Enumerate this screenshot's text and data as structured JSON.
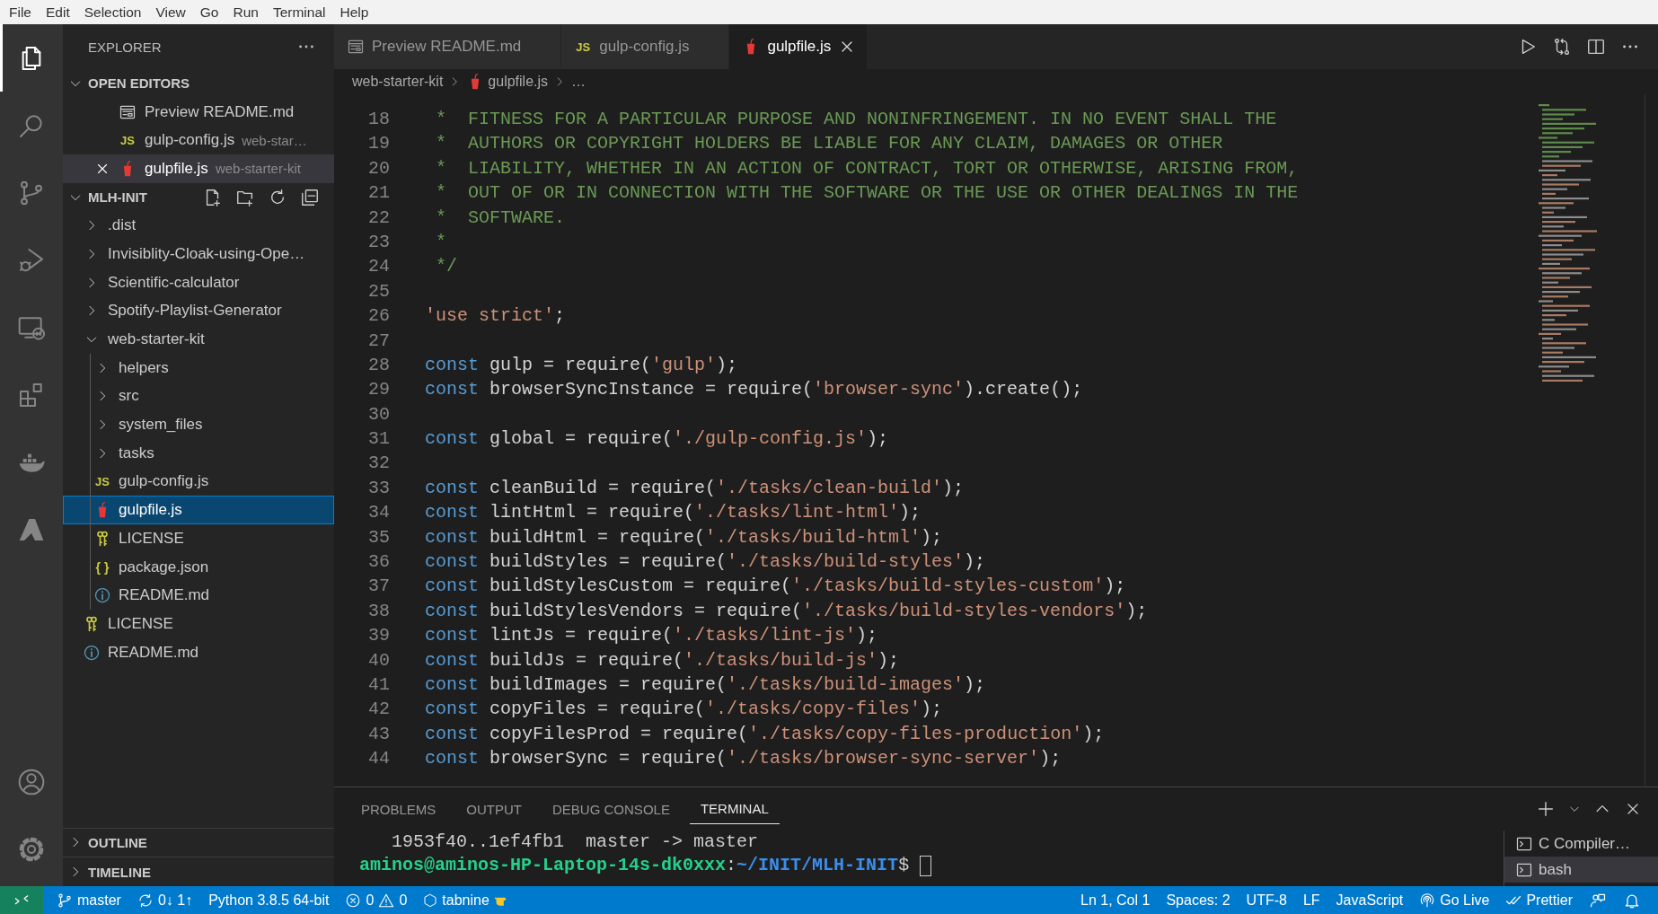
{
  "menu": [
    "File",
    "Edit",
    "Selection",
    "View",
    "Go",
    "Run",
    "Terminal",
    "Help"
  ],
  "activity_bar": {
    "top": [
      {
        "kind": "explorer",
        "selected": true
      },
      {
        "kind": "search",
        "selected": false
      },
      {
        "kind": "source-control",
        "selected": false
      },
      {
        "kind": "run-debug",
        "selected": false
      },
      {
        "kind": "remote",
        "selected": false
      },
      {
        "kind": "extensions",
        "selected": false
      },
      {
        "kind": "docker",
        "selected": false
      },
      {
        "kind": "azure",
        "selected": false
      }
    ],
    "bottom": [
      {
        "kind": "account",
        "selected": false
      },
      {
        "kind": "settings",
        "selected": false
      }
    ]
  },
  "sidebar": {
    "title": "EXPLORER",
    "open_editors": {
      "title": "OPEN EDITORS",
      "expanded": true,
      "items": [
        {
          "kind": "preview",
          "name": "Preview README.md",
          "selected": false
        },
        {
          "kind": "js",
          "icon_label": "JS",
          "name": "gulp-config.js",
          "description": "web-star…",
          "selected": false
        },
        {
          "kind": "gulp",
          "name": "gulpfile.js",
          "description": "web-starter-kit",
          "selected": true
        }
      ]
    },
    "folder": {
      "title": "MLH-INIT",
      "expanded": true,
      "children": [
        {
          "kind": "folder",
          "name": ".dist",
          "expanded": false,
          "selected": false
        },
        {
          "kind": "folder",
          "name": "Invisiblity-Cloak-using-Ope…",
          "expanded": false,
          "selected": false
        },
        {
          "kind": "folder",
          "name": "Scientific-calculator",
          "expanded": false,
          "selected": false
        },
        {
          "kind": "folder",
          "name": "Spotify-Playlist-Generator",
          "expanded": false,
          "selected": false
        },
        {
          "kind": "folder",
          "name": "web-starter-kit",
          "expanded": true,
          "selected": false,
          "children": [
            {
              "kind": "folder",
              "name": "helpers",
              "expanded": false,
              "selected": false
            },
            {
              "kind": "folder",
              "name": "src",
              "expanded": false,
              "selected": false
            },
            {
              "kind": "folder",
              "name": "system_files",
              "expanded": false,
              "selected": false
            },
            {
              "kind": "folder",
              "name": "tasks",
              "expanded": false,
              "selected": false
            },
            {
              "kind": "js",
              "icon_label": "JS",
              "name": "gulp-config.js",
              "selected": false
            },
            {
              "kind": "gulp",
              "name": "gulpfile.js",
              "selected": true
            },
            {
              "kind": "license",
              "name": "LICENSE",
              "selected": false
            },
            {
              "kind": "json",
              "icon_label": "{ }",
              "name": "package.json",
              "selected": false
            },
            {
              "kind": "info",
              "name": "README.md",
              "selected": false
            }
          ]
        },
        {
          "kind": "license",
          "name": "LICENSE",
          "selected": false
        },
        {
          "kind": "info",
          "name": "README.md",
          "selected": false
        }
      ]
    },
    "collapsed_sections": [
      {
        "title": "OUTLINE",
        "expanded": false
      },
      {
        "title": "TIMELINE",
        "expanded": false
      }
    ]
  },
  "tabs": [
    {
      "kind": "preview",
      "label": "Preview README.md",
      "selected": false
    },
    {
      "kind": "js",
      "icon_label": "JS",
      "label": "gulp-config.js",
      "selected": false
    },
    {
      "kind": "gulp",
      "label": "gulpfile.js",
      "selected": true
    }
  ],
  "breadcrumbs": [
    {
      "kind": "folder",
      "text": "web-starter-kit"
    },
    {
      "kind": "gulp",
      "text": "gulpfile.js"
    },
    {
      "kind": "more",
      "text": "…"
    }
  ],
  "code_lines": [
    {
      "number": "18",
      "tokens": [
        {
          "kind": "comment",
          "text": " *  FITNESS FOR A PARTICULAR PURPOSE AND NONINFRINGEMENT. IN NO EVENT SHALL THE"
        }
      ]
    },
    {
      "number": "19",
      "tokens": [
        {
          "kind": "comment",
          "text": " *  AUTHORS OR COPYRIGHT HOLDERS BE LIABLE FOR ANY CLAIM, DAMAGES OR OTHER"
        }
      ]
    },
    {
      "number": "20",
      "tokens": [
        {
          "kind": "comment",
          "text": " *  LIABILITY, WHETHER IN AN ACTION OF CONTRACT, TORT OR OTHERWISE, ARISING FROM,"
        }
      ]
    },
    {
      "number": "21",
      "tokens": [
        {
          "kind": "comment",
          "text": " *  OUT OF OR IN CONNECTION WITH THE SOFTWARE OR THE USE OR OTHER DEALINGS IN THE"
        }
      ]
    },
    {
      "number": "22",
      "tokens": [
        {
          "kind": "comment",
          "text": " *  SOFTWARE."
        }
      ]
    },
    {
      "number": "23",
      "tokens": [
        {
          "kind": "comment",
          "text": " *"
        }
      ]
    },
    {
      "number": "24",
      "tokens": [
        {
          "kind": "comment",
          "text": " */"
        }
      ]
    },
    {
      "number": "25"
    },
    {
      "number": "26",
      "tokens": [
        {
          "kind": "string",
          "text": "'use strict'"
        },
        {
          "kind": "plain",
          "text": ";"
        }
      ]
    },
    {
      "number": "27"
    },
    {
      "number": "28",
      "tokens": [
        {
          "kind": "keyword",
          "text": "const"
        },
        {
          "kind": "plain",
          "text": " gulp = require("
        },
        {
          "kind": "string",
          "text": "'gulp'"
        },
        {
          "kind": "plain",
          "text": ");"
        }
      ]
    },
    {
      "number": "29",
      "tokens": [
        {
          "kind": "keyword",
          "text": "const"
        },
        {
          "kind": "plain",
          "text": " browserSyncInstance = require("
        },
        {
          "kind": "string",
          "text": "'browser-sync'"
        },
        {
          "kind": "plain",
          "text": ").create();"
        }
      ]
    },
    {
      "number": "30"
    },
    {
      "number": "31",
      "tokens": [
        {
          "kind": "keyword",
          "text": "const"
        },
        {
          "kind": "plain",
          "text": " global = require("
        },
        {
          "kind": "string",
          "text": "'./gulp-config.js'"
        },
        {
          "kind": "plain",
          "text": ");"
        }
      ]
    },
    {
      "number": "32"
    },
    {
      "number": "33",
      "tokens": [
        {
          "kind": "keyword",
          "text": "const"
        },
        {
          "kind": "plain",
          "text": " cleanBuild = require("
        },
        {
          "kind": "string",
          "text": "'./tasks/clean-build'"
        },
        {
          "kind": "plain",
          "text": ");"
        }
      ]
    },
    {
      "number": "34",
      "tokens": [
        {
          "kind": "keyword",
          "text": "const"
        },
        {
          "kind": "plain",
          "text": " lintHtml = require("
        },
        {
          "kind": "string",
          "text": "'./tasks/lint-html'"
        },
        {
          "kind": "plain",
          "text": ");"
        }
      ]
    },
    {
      "number": "35",
      "tokens": [
        {
          "kind": "keyword",
          "text": "const"
        },
        {
          "kind": "plain",
          "text": " buildHtml = require("
        },
        {
          "kind": "string",
          "text": "'./tasks/build-html'"
        },
        {
          "kind": "plain",
          "text": ");"
        }
      ]
    },
    {
      "number": "36",
      "tokens": [
        {
          "kind": "keyword",
          "text": "const"
        },
        {
          "kind": "plain",
          "text": " buildStyles = require("
        },
        {
          "kind": "string",
          "text": "'./tasks/build-styles'"
        },
        {
          "kind": "plain",
          "text": ");"
        }
      ]
    },
    {
      "number": "37",
      "tokens": [
        {
          "kind": "keyword",
          "text": "const"
        },
        {
          "kind": "plain",
          "text": " buildStylesCustom = require("
        },
        {
          "kind": "string",
          "text": "'./tasks/build-styles-custom'"
        },
        {
          "kind": "plain",
          "text": ");"
        }
      ]
    },
    {
      "number": "38",
      "tokens": [
        {
          "kind": "keyword",
          "text": "const"
        },
        {
          "kind": "plain",
          "text": " buildStylesVendors = require("
        },
        {
          "kind": "string",
          "text": "'./tasks/build-styles-vendors'"
        },
        {
          "kind": "plain",
          "text": ");"
        }
      ]
    },
    {
      "number": "39",
      "tokens": [
        {
          "kind": "keyword",
          "text": "const"
        },
        {
          "kind": "plain",
          "text": " lintJs = require("
        },
        {
          "kind": "string",
          "text": "'./tasks/lint-js'"
        },
        {
          "kind": "plain",
          "text": ");"
        }
      ]
    },
    {
      "number": "40",
      "tokens": [
        {
          "kind": "keyword",
          "text": "const"
        },
        {
          "kind": "plain",
          "text": " buildJs = require("
        },
        {
          "kind": "string",
          "text": "'./tasks/build-js'"
        },
        {
          "kind": "plain",
          "text": ");"
        }
      ]
    },
    {
      "number": "41",
      "tokens": [
        {
          "kind": "keyword",
          "text": "const"
        },
        {
          "kind": "plain",
          "text": " buildImages = require("
        },
        {
          "kind": "string",
          "text": "'./tasks/build-images'"
        },
        {
          "kind": "plain",
          "text": ");"
        }
      ]
    },
    {
      "number": "42",
      "tokens": [
        {
          "kind": "keyword",
          "text": "const"
        },
        {
          "kind": "plain",
          "text": " copyFiles = require("
        },
        {
          "kind": "string",
          "text": "'./tasks/copy-files'"
        },
        {
          "kind": "plain",
          "text": ");"
        }
      ]
    },
    {
      "number": "43",
      "tokens": [
        {
          "kind": "keyword",
          "text": "const"
        },
        {
          "kind": "plain",
          "text": " copyFilesProd = require("
        },
        {
          "kind": "string",
          "text": "'./tasks/copy-files-production'"
        },
        {
          "kind": "plain",
          "text": ");"
        }
      ]
    },
    {
      "number": "44",
      "tokens": [
        {
          "kind": "keyword",
          "text": "const"
        },
        {
          "kind": "plain",
          "text": " browserSync = require("
        },
        {
          "kind": "string",
          "text": "'./tasks/browser-sync-server'"
        },
        {
          "kind": "plain",
          "text": ");"
        }
      ]
    }
  ],
  "panel": {
    "tabs": [
      {
        "label": "PROBLEMS",
        "selected": false
      },
      {
        "label": "OUTPUT",
        "selected": false
      },
      {
        "label": "DEBUG CONSOLE",
        "selected": false
      },
      {
        "label": "TERMINAL",
        "selected": true
      }
    ],
    "terminal_lines": [
      {
        "parts": [
          {
            "kind": "output",
            "text": "   1953f40..1ef4fb1  master -> master"
          }
        ]
      },
      {
        "parts": [
          {
            "kind": "user",
            "text": "aminos@aminos-HP-Laptop-14s-dk0xxx"
          },
          {
            "kind": "output",
            "text": ":"
          },
          {
            "kind": "path",
            "text": "~/INIT/MLH-INIT"
          },
          {
            "kind": "output",
            "text": "$ "
          }
        ],
        "cursor": true
      }
    ],
    "terminals": [
      {
        "name": "C Compiler…",
        "selected": false
      },
      {
        "name": "bash",
        "selected": true
      }
    ]
  },
  "status_bar": {
    "left": [
      {
        "kind": "remote"
      },
      {
        "kind": "branch",
        "text": "master"
      },
      {
        "kind": "sync",
        "text": "0↓ 1↑"
      },
      {
        "kind": "plain",
        "text": "Python 3.8.5 64-bit"
      },
      {
        "kind": "problems",
        "errors": "0",
        "warnings": "0"
      },
      {
        "kind": "tabnine",
        "text": "tabnine"
      }
    ],
    "right": [
      {
        "kind": "plain",
        "text": "Ln 1, Col 1"
      },
      {
        "kind": "plain",
        "text": "Spaces: 2"
      },
      {
        "kind": "plain",
        "text": "UTF-8"
      },
      {
        "kind": "plain",
        "text": "LF"
      },
      {
        "kind": "plain",
        "text": "JavaScript"
      },
      {
        "kind": "golive",
        "text": "Go Live"
      },
      {
        "kind": "prettier",
        "text": "Prettier"
      },
      {
        "kind": "feedback"
      },
      {
        "kind": "bell"
      }
    ]
  }
}
